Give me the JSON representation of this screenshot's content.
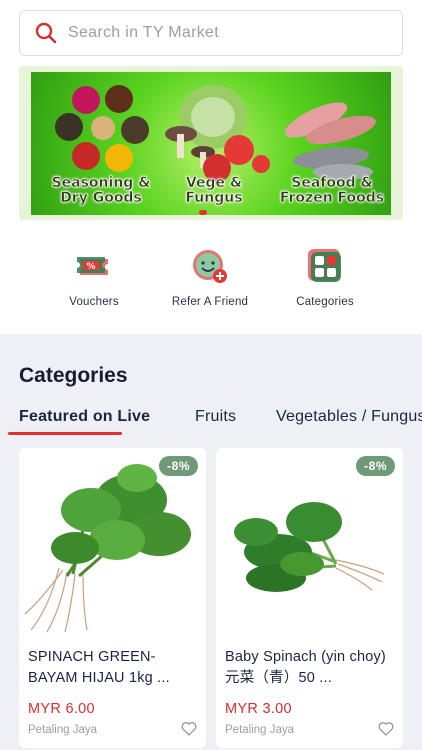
{
  "search": {
    "placeholder": "Search in TY Market"
  },
  "banner": {
    "labels": [
      "Seasoning &\nDry Goods",
      "Vege &\nFungus",
      "Seafood &\nFrozen Foods"
    ]
  },
  "quick_actions": [
    {
      "label": "Vouchers",
      "icon": "voucher-icon"
    },
    {
      "label": "Refer A Friend",
      "icon": "refer-friend-icon"
    },
    {
      "label": "Categories",
      "icon": "categories-icon"
    }
  ],
  "categories": {
    "title": "Categories",
    "tabs": [
      "Featured on Live",
      "Fruits",
      "Vegetables / Fungus"
    ],
    "active_tab": "Featured on Live"
  },
  "products": [
    {
      "discount": "-8%",
      "name": "SPINACH GREEN-BAYAM HIJAU 1kg ...",
      "price": "MYR 6.00",
      "location": "Petaling Jaya"
    },
    {
      "discount": "-8%",
      "name": "Baby Spinach (yin choy) 元菜（青）50 ...",
      "price": "MYR 3.00",
      "location": "Petaling Jaya"
    }
  ],
  "colors": {
    "accent": "#e0312f",
    "badge": "#6f9a78",
    "section_bg": "#eef0f5"
  }
}
